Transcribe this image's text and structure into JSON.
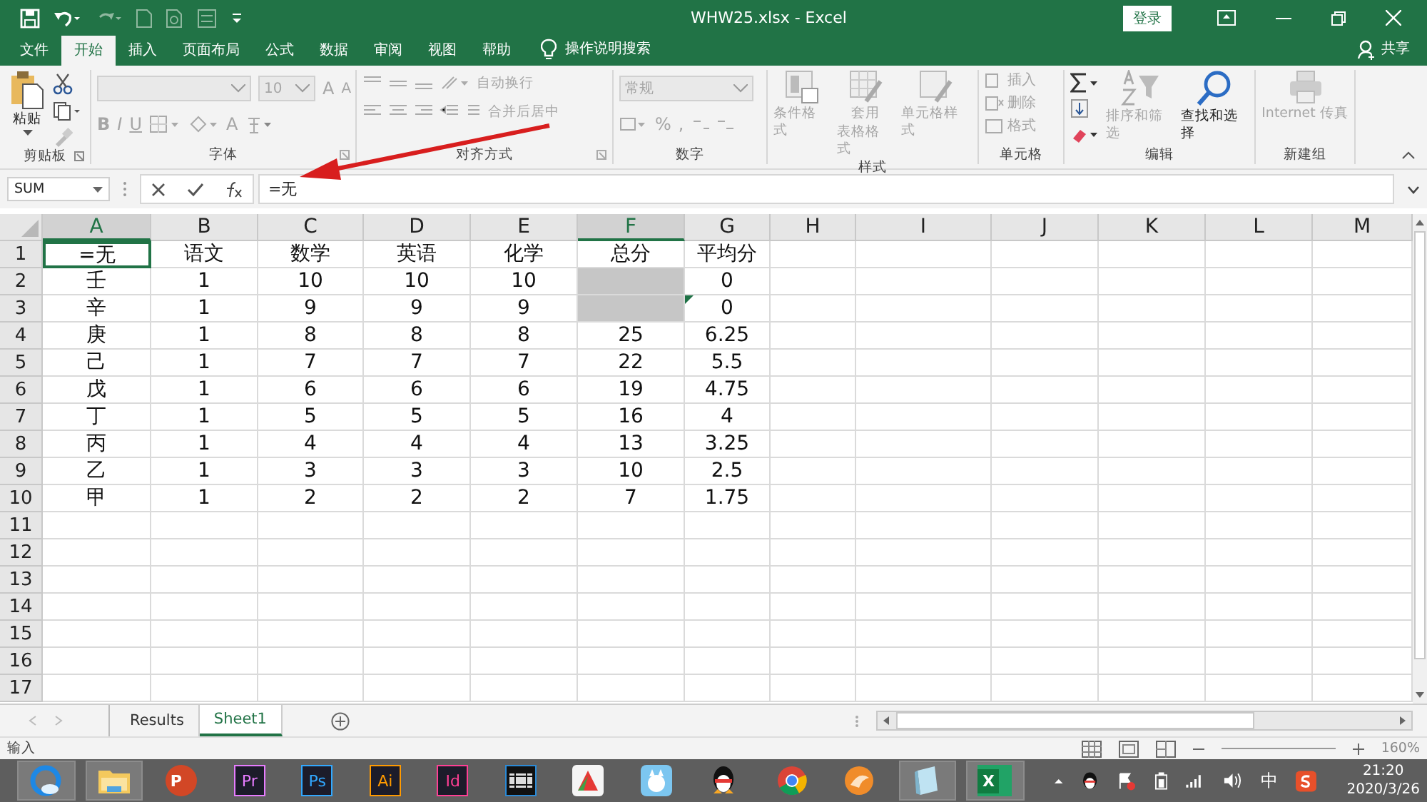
{
  "window": {
    "title": "WHW25.xlsx  -  Excel",
    "login": "登录"
  },
  "ribbon_tabs": [
    {
      "label": "文件",
      "selected": false
    },
    {
      "label": "开始",
      "selected": true
    },
    {
      "label": "插入",
      "selected": false
    },
    {
      "label": "页面布局",
      "selected": false
    },
    {
      "label": "公式",
      "selected": false
    },
    {
      "label": "数据",
      "selected": false
    },
    {
      "label": "审阅",
      "selected": false
    },
    {
      "label": "视图",
      "selected": false
    },
    {
      "label": "帮助",
      "selected": false
    }
  ],
  "tell_me": "操作说明搜索",
  "share": "共享",
  "ribbon": {
    "clipboard": {
      "label": "剪贴板",
      "paste": "粘贴"
    },
    "font": {
      "label": "字体",
      "size": "10",
      "bold": "B",
      "italic": "I",
      "underline": "U",
      "grow": "A",
      "shrink": "A",
      "font_color": "A",
      "disabled": true
    },
    "alignment": {
      "label": "对齐方式",
      "wrap": "自动换行",
      "merge": "合并后居中",
      "disabled": true
    },
    "number": {
      "label": "数字",
      "format": "常规",
      "percent": "%",
      "comma": ",",
      "disabled": true
    },
    "styles": {
      "label": "样式",
      "conditional": "条件格式",
      "table_1": "套用",
      "table_2": "表格格式",
      "cell_styles": "单元格样式",
      "disabled": true
    },
    "cells": {
      "label": "单元格",
      "insert": "插入",
      "delete": "删除",
      "format": "格式",
      "disabled": true
    },
    "editing": {
      "label": "编辑",
      "sort": "排序和筛选",
      "find": "查找和选择",
      "sort_disabled": true,
      "find_disabled": false
    },
    "new_group": {
      "label": "新建组",
      "fax": "Internet 传真",
      "disabled": true
    }
  },
  "name_box": "SUM",
  "formula": "=无",
  "columns": [
    {
      "label": "A",
      "selected": true
    },
    {
      "label": "B",
      "selected": false
    },
    {
      "label": "C",
      "selected": false
    },
    {
      "label": "D",
      "selected": false
    },
    {
      "label": "E",
      "selected": false
    },
    {
      "label": "F",
      "selected": true
    },
    {
      "label": "G",
      "selected": false
    },
    {
      "label": "H",
      "selected": false
    },
    {
      "label": "I",
      "selected": false
    },
    {
      "label": "J",
      "selected": false
    },
    {
      "label": "K",
      "selected": false
    },
    {
      "label": "L",
      "selected": false
    },
    {
      "label": "M",
      "selected": false
    }
  ],
  "rows": [
    {
      "header": "1",
      "cells": [
        {
          "text": "=无",
          "active": true
        },
        {
          "text": "语文"
        },
        {
          "text": "数学"
        },
        {
          "text": "英语"
        },
        {
          "text": "化学"
        },
        {
          "text": "总分"
        },
        {
          "text": "平均分"
        }
      ]
    },
    {
      "header": "2",
      "cells": [
        {
          "text": "壬"
        },
        {
          "text": "1"
        },
        {
          "text": "10"
        },
        {
          "text": "10"
        },
        {
          "text": "10"
        },
        {
          "selected": true
        },
        {
          "text": "0"
        }
      ]
    },
    {
      "header": "3",
      "cells": [
        {
          "text": "辛"
        },
        {
          "text": "1"
        },
        {
          "text": "9"
        },
        {
          "text": "9"
        },
        {
          "text": "9"
        },
        {
          "selected": true
        },
        {
          "text": "0",
          "error_flag": true
        }
      ]
    },
    {
      "header": "4",
      "cells": [
        {
          "text": "庚"
        },
        {
          "text": "1"
        },
        {
          "text": "8"
        },
        {
          "text": "8"
        },
        {
          "text": "8"
        },
        {
          "text": "25"
        },
        {
          "text": "6.25"
        }
      ]
    },
    {
      "header": "5",
      "cells": [
        {
          "text": "己"
        },
        {
          "text": "1"
        },
        {
          "text": "7"
        },
        {
          "text": "7"
        },
        {
          "text": "7"
        },
        {
          "text": "22"
        },
        {
          "text": "5.5"
        }
      ]
    },
    {
      "header": "6",
      "cells": [
        {
          "text": "戊"
        },
        {
          "text": "1"
        },
        {
          "text": "6"
        },
        {
          "text": "6"
        },
        {
          "text": "6"
        },
        {
          "text": "19"
        },
        {
          "text": "4.75"
        }
      ]
    },
    {
      "header": "7",
      "cells": [
        {
          "text": "丁"
        },
        {
          "text": "1"
        },
        {
          "text": "5"
        },
        {
          "text": "5"
        },
        {
          "text": "5"
        },
        {
          "text": "16"
        },
        {
          "text": "4"
        }
      ]
    },
    {
      "header": "8",
      "cells": [
        {
          "text": "丙"
        },
        {
          "text": "1"
        },
        {
          "text": "4"
        },
        {
          "text": "4"
        },
        {
          "text": "4"
        },
        {
          "text": "13"
        },
        {
          "text": "3.25"
        }
      ]
    },
    {
      "header": "9",
      "cells": [
        {
          "text": "乙"
        },
        {
          "text": "1"
        },
        {
          "text": "3"
        },
        {
          "text": "3"
        },
        {
          "text": "3"
        },
        {
          "text": "10"
        },
        {
          "text": "2.5"
        }
      ]
    },
    {
      "header": "10",
      "cells": [
        {
          "text": "甲"
        },
        {
          "text": "1"
        },
        {
          "text": "2"
        },
        {
          "text": "2"
        },
        {
          "text": "2"
        },
        {
          "text": "7"
        },
        {
          "text": "1.75"
        }
      ]
    },
    {
      "header": "11"
    },
    {
      "header": "12"
    },
    {
      "header": "13"
    },
    {
      "header": "14"
    },
    {
      "header": "15"
    },
    {
      "header": "16"
    },
    {
      "header": "17"
    }
  ],
  "sheet_tabs": [
    {
      "label": "Results",
      "selected": false
    },
    {
      "label": "Sheet1",
      "selected": true
    }
  ],
  "status_bar": {
    "mode": "输入",
    "zoom": "160%"
  },
  "taskbar": [
    {
      "kind": "browser",
      "active": true
    },
    {
      "kind": "folder",
      "active": true
    },
    {
      "kind": "slides",
      "label": "P",
      "active": false
    },
    {
      "kind": "app",
      "label": "Pr",
      "color": "#e77cff",
      "active": false
    },
    {
      "kind": "app",
      "label": "Ps",
      "color": "#31a8ff",
      "active": false
    },
    {
      "kind": "app",
      "label": "Ai",
      "color": "#ff9a00",
      "active": false
    },
    {
      "kind": "app",
      "label": "Id",
      "color": "#ff3f94",
      "active": false
    },
    {
      "kind": "film",
      "active": false
    },
    {
      "kind": "checker",
      "active": false
    },
    {
      "kind": "cat",
      "active": false
    },
    {
      "kind": "penguin",
      "active": false
    },
    {
      "kind": "chrome",
      "active": false
    },
    {
      "kind": "fox",
      "active": false
    },
    {
      "kind": "notebook",
      "active": true
    },
    {
      "kind": "sheet",
      "label": "X",
      "active": true
    }
  ],
  "tray": {
    "ime": "中",
    "time": "21:20",
    "date": "2020/3/26"
  }
}
